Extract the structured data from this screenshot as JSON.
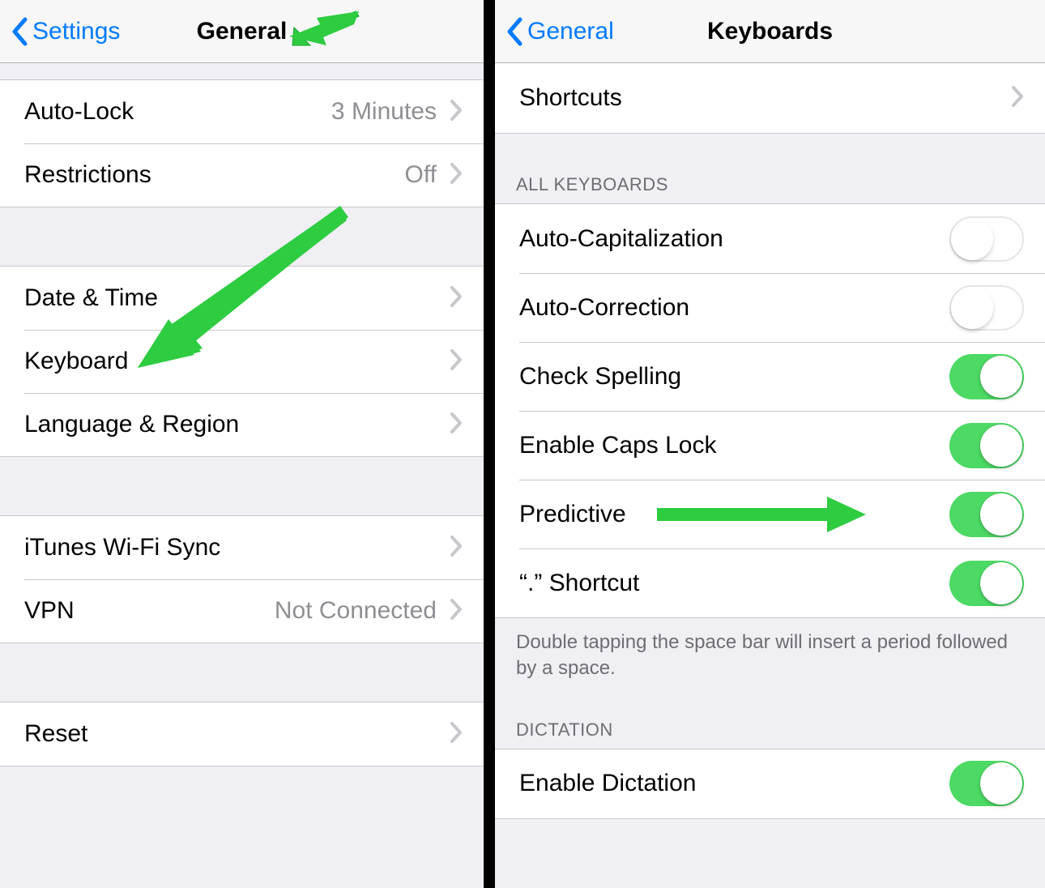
{
  "left": {
    "navbar": {
      "back": "Settings",
      "title": "General"
    },
    "groups": [
      {
        "cells": [
          {
            "label": "Auto-Lock",
            "detail": "3 Minutes",
            "disclosure": true
          },
          {
            "label": "Restrictions",
            "detail": "Off",
            "disclosure": true
          }
        ]
      },
      {
        "cells": [
          {
            "label": "Date & Time",
            "disclosure": true
          },
          {
            "label": "Keyboard",
            "disclosure": true
          },
          {
            "label": "Language & Region",
            "disclosure": true
          }
        ]
      },
      {
        "cells": [
          {
            "label": "iTunes Wi-Fi Sync",
            "disclosure": true
          },
          {
            "label": "VPN",
            "detail": "Not Connected",
            "disclosure": true
          }
        ]
      },
      {
        "cells": [
          {
            "label": "Reset",
            "disclosure": true
          }
        ]
      }
    ]
  },
  "right": {
    "navbar": {
      "back": "General",
      "title": "Keyboards"
    },
    "sections": {
      "top": {
        "cells": [
          {
            "label": "Shortcuts",
            "disclosure": true
          }
        ]
      },
      "all": {
        "header": "ALL KEYBOARDS",
        "cells": [
          {
            "label": "Auto-Capitalization",
            "on": false
          },
          {
            "label": "Auto-Correction",
            "on": false
          },
          {
            "label": "Check Spelling",
            "on": true
          },
          {
            "label": "Enable Caps Lock",
            "on": true
          },
          {
            "label": "Predictive",
            "on": true
          },
          {
            "label": "“.” Shortcut",
            "on": true
          }
        ],
        "footer": "Double tapping the space bar will insert a period followed by a space."
      },
      "dictation": {
        "header": "DICTATION",
        "cells": [
          {
            "label": "Enable Dictation",
            "on": true
          }
        ]
      }
    }
  }
}
